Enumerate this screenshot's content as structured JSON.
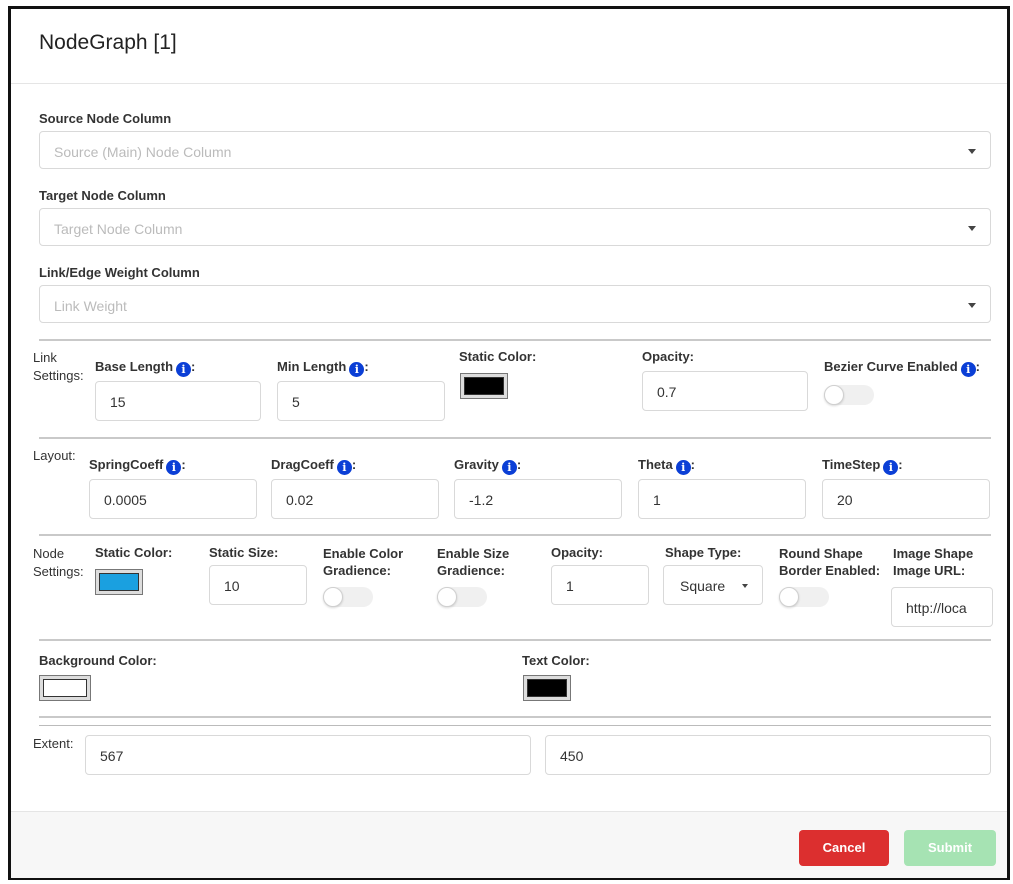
{
  "modal": {
    "title": "NodeGraph [1]"
  },
  "source": {
    "label": "Source Node Column",
    "placeholder": "Source (Main) Node Column"
  },
  "target": {
    "label": "Target Node Column",
    "placeholder": "Target Node Column"
  },
  "weight": {
    "label": "Link/Edge Weight Column",
    "placeholder": "Link Weight"
  },
  "link_settings": {
    "section_label_1": "Link",
    "section_label_2": "Settings:",
    "base_length_label": "Base Length",
    "base_length_value": "15",
    "min_length_label": "Min Length",
    "min_length_value": "5",
    "static_color_label": "Static Color:",
    "static_color": "#000000",
    "opacity_label": "Opacity:",
    "opacity_value": "0.7",
    "bezier_label": "Bezier Curve Enabled",
    "bezier_enabled": false
  },
  "layout": {
    "section_label": "Layout:",
    "spring_label": "SpringCoeff",
    "spring_value": "0.0005",
    "drag_label": "DragCoeff",
    "drag_value": "0.02",
    "gravity_label": "Gravity",
    "gravity_value": "-1.2",
    "theta_label": "Theta",
    "theta_value": "1",
    "timestep_label": "TimeStep",
    "timestep_value": "20"
  },
  "node_settings": {
    "section_label_1": "Node",
    "section_label_2": "Settings:",
    "static_color_label": "Static Color:",
    "static_color": "#1aa0e0",
    "static_size_label": "Static Size:",
    "static_size_value": "10",
    "color_grad_label_1": "Enable Color",
    "color_grad_label_2": "Gradience:",
    "color_grad_enabled": false,
    "size_grad_label_1": "Enable Size",
    "size_grad_label_2": "Gradience:",
    "size_grad_enabled": false,
    "opacity_label": "Opacity:",
    "opacity_value": "1",
    "shape_type_label": "Shape Type:",
    "shape_type_value": "Square",
    "round_border_label_1": "Round Shape",
    "round_border_label_2": "Border Enabled:",
    "round_border_enabled": false,
    "image_url_label_1": "Image Shape",
    "image_url_label_2": "Image URL:",
    "image_url_value": "http://loca"
  },
  "colors": {
    "background_label": "Background Color:",
    "background_color": "#ffffff",
    "text_label": "Text Color:",
    "text_color": "#000000"
  },
  "extent": {
    "label": "Extent:",
    "width_value": "567",
    "height_value": "450"
  },
  "info_glyph": "i",
  "footer": {
    "cancel_label": "Cancel",
    "cancel_color": "#dc2f2f",
    "submit_label": "Submit",
    "submit_color": "#a6e3b3"
  }
}
